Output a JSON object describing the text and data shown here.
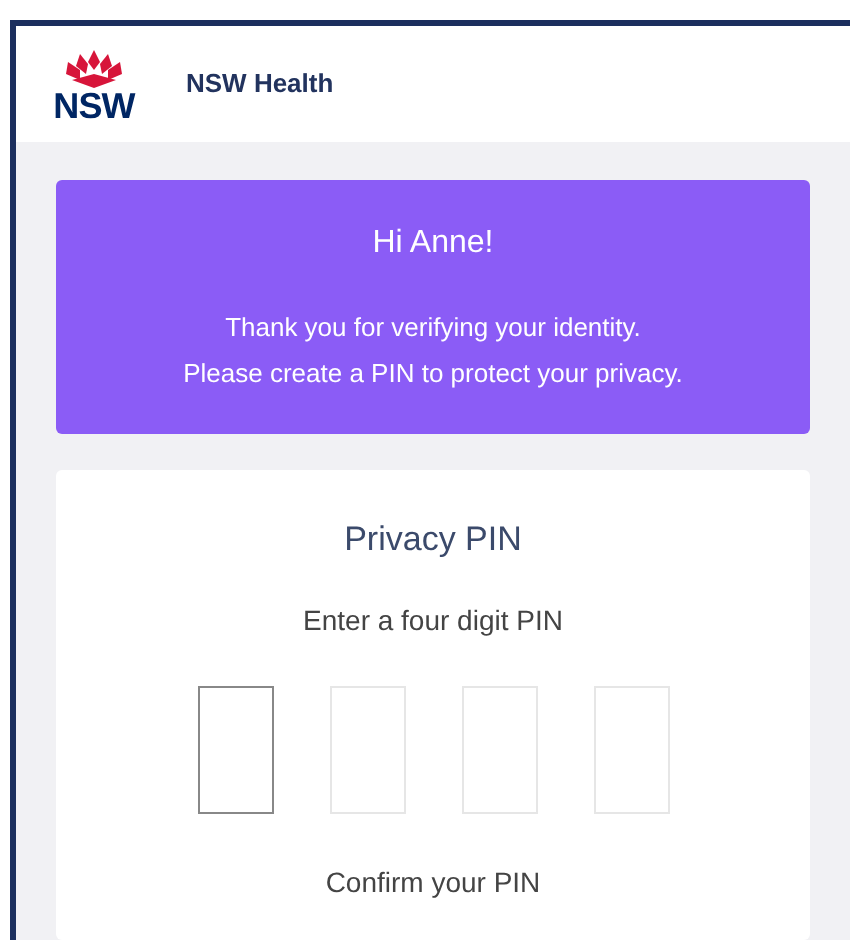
{
  "header": {
    "logo_text": "NSW",
    "title": "NSW Health"
  },
  "banner": {
    "greeting": "Hi Anne!",
    "message": "Thank you for verifying your identity.",
    "message_2": "Please create a PIN to protect your privacy."
  },
  "pin_card": {
    "title": "Privacy PIN",
    "prompt": "Enter a four digit PIN",
    "digits": [
      {
        "focused": true
      },
      {
        "focused": false
      },
      {
        "focused": false
      },
      {
        "focused": false
      }
    ],
    "confirm_label": "Confirm your PIN"
  }
}
